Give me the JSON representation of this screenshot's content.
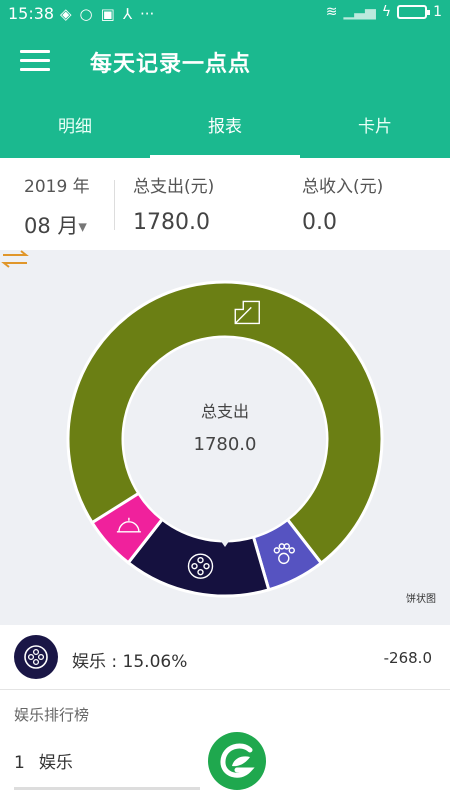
{
  "statusbar": {
    "time": "15:38",
    "battery_level": "1"
  },
  "appbar": {
    "title": "每天记录一点点"
  },
  "tabs": [
    {
      "label": "明细",
      "active": false
    },
    {
      "label": "报表",
      "active": true
    },
    {
      "label": "卡片",
      "active": false
    }
  ],
  "summary": {
    "year": "2019 年",
    "month": "08 月",
    "expense_label": "总支出(元)",
    "expense_value": "1780.0",
    "income_label": "总收入(元)",
    "income_value": "0.0"
  },
  "chart": {
    "center_title": "总支出",
    "center_value": "1780.0",
    "type_label": "饼状图"
  },
  "chart_data": {
    "type": "pie",
    "total": 1780.0,
    "slices": [
      {
        "category": "leaf-icon",
        "color": "#6b7f14",
        "fraction": 0.735
      },
      {
        "category": "paw-icon",
        "color": "#5653c1",
        "fraction": 0.06
      },
      {
        "category": "娱乐",
        "icon": "film-reel-icon",
        "color": "#15113f",
        "fraction": 0.1506,
        "value": 268.0
      },
      {
        "category": "cloche-icon",
        "color": "#f0219c",
        "fraction": 0.055
      }
    ]
  },
  "detail": {
    "label": "娱乐 : 15.06%",
    "amount": "-268.0",
    "icon": "film-reel-icon"
  },
  "ranking": {
    "title": "娱乐排行榜",
    "items": [
      {
        "index": "1",
        "name": "娱乐"
      }
    ]
  }
}
